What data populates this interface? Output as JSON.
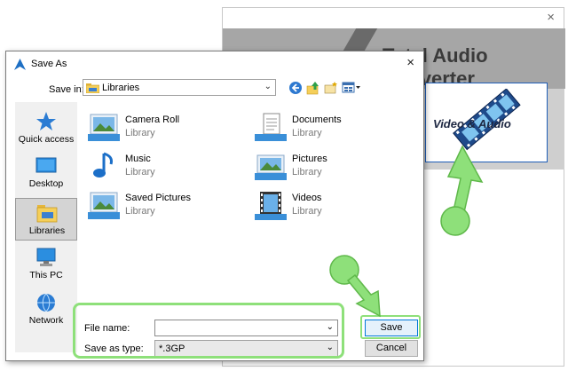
{
  "background_app": {
    "title_fragment": "Total Audio Converter",
    "close_symbol": "×",
    "video_audio_label": "Video & Audio"
  },
  "dialog": {
    "title": "Save As",
    "close_symbol": "×",
    "save_in_label": "Save in:",
    "save_in_value": "Libraries",
    "places": [
      {
        "label": "Quick access",
        "icon": "star-icon"
      },
      {
        "label": "Desktop",
        "icon": "desktop-icon"
      },
      {
        "label": "Libraries",
        "icon": "libraries-icon",
        "selected": true
      },
      {
        "label": "This PC",
        "icon": "computer-icon"
      },
      {
        "label": "Network",
        "icon": "network-icon"
      }
    ],
    "items": [
      {
        "name": "Camera Roll",
        "type": "Library"
      },
      {
        "name": "Documents",
        "type": "Library"
      },
      {
        "name": "Music",
        "type": "Library"
      },
      {
        "name": "Pictures",
        "type": "Library"
      },
      {
        "name": "Saved Pictures",
        "type": "Library"
      },
      {
        "name": "Videos",
        "type": "Library"
      }
    ],
    "file_name_label": "File name:",
    "file_name_value": "",
    "save_as_type_label": "Save as type:",
    "save_as_type_value": "*.3GP",
    "save_button": "Save",
    "cancel_button": "Cancel"
  },
  "colors": {
    "highlight": "#8ee07a",
    "accent": "#0078d7"
  }
}
